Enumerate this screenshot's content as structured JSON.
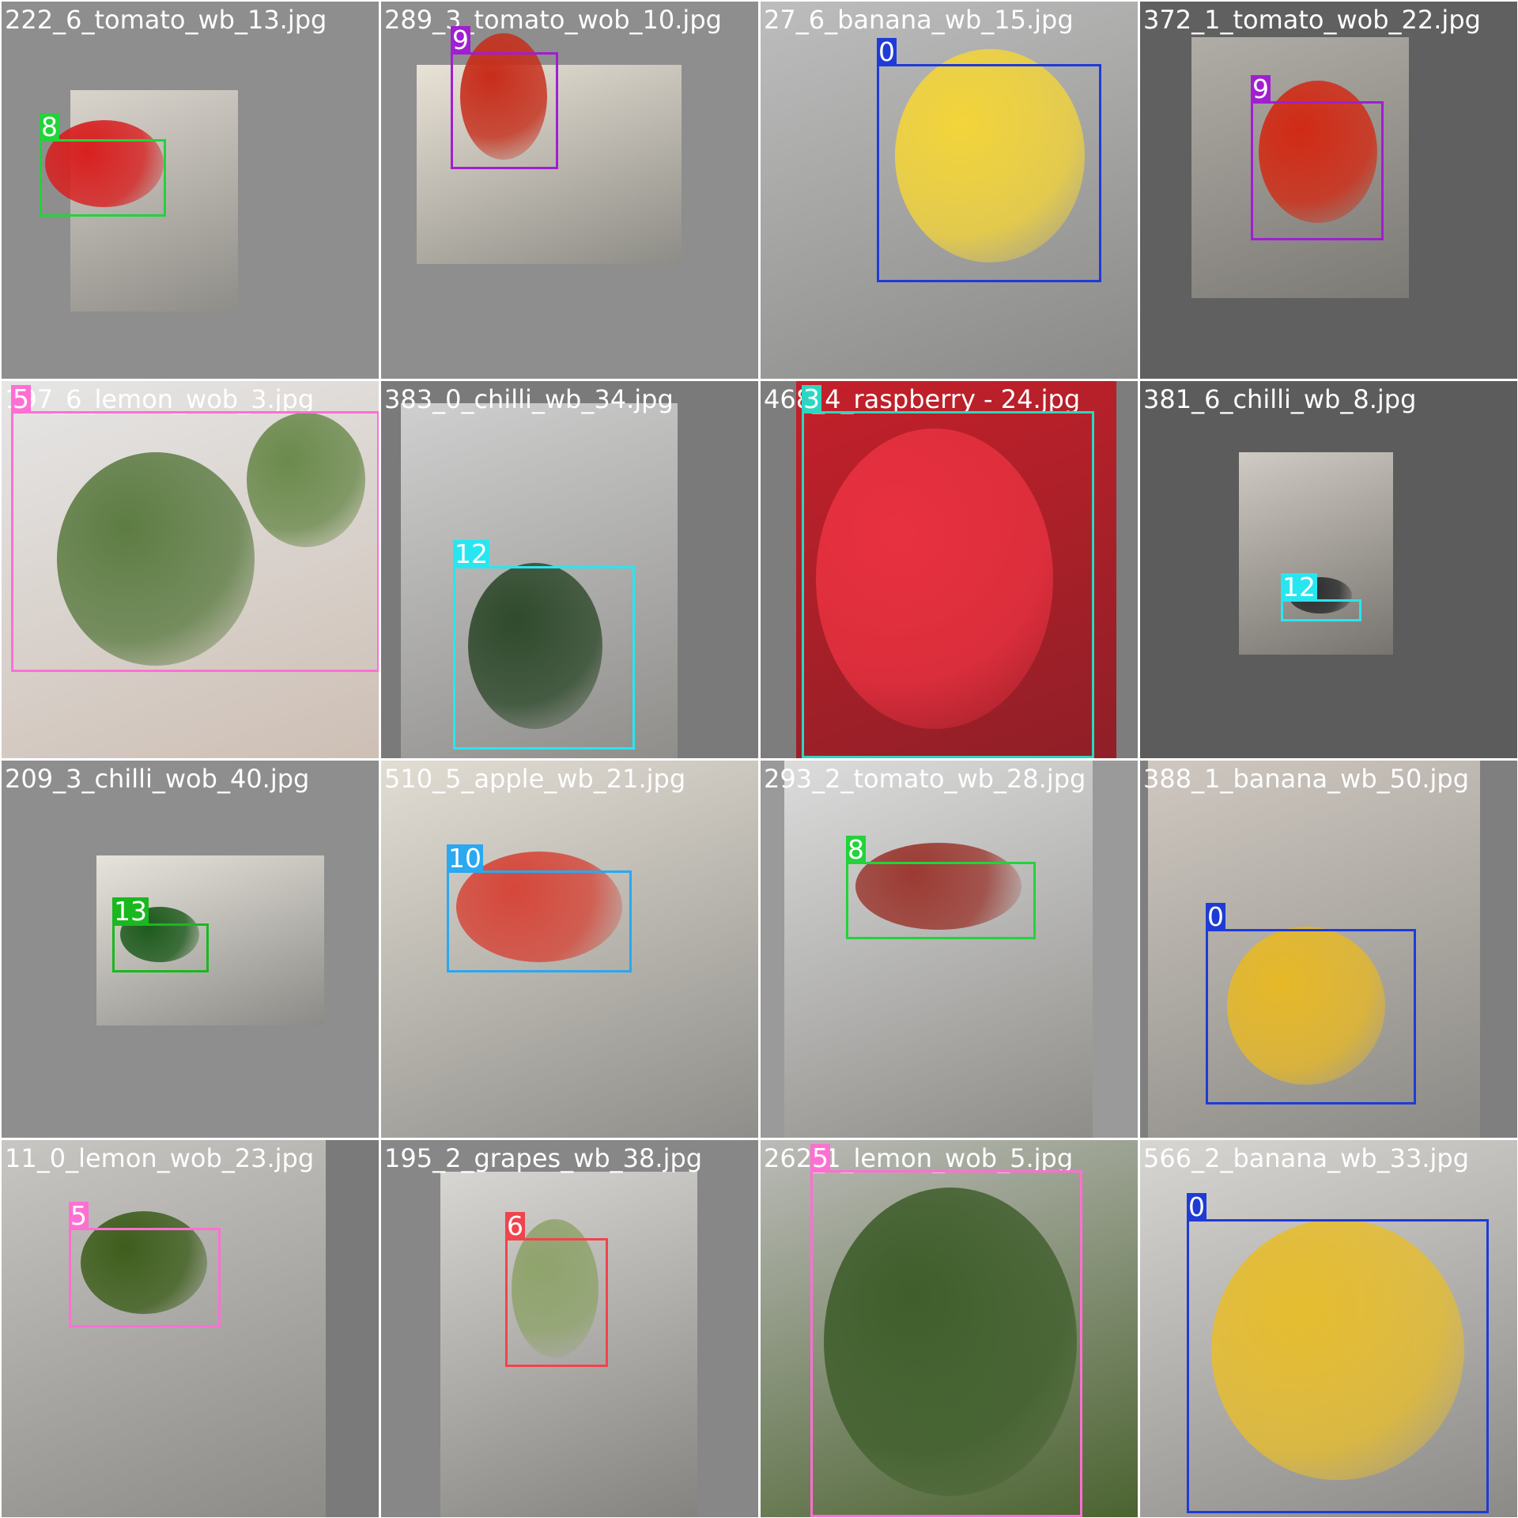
{
  "tiles": [
    {
      "filename": "222_6_tomato_wb_13.jpg",
      "boxes": [
        {
          "label": "8",
          "color": "#22d33a"
        }
      ]
    },
    {
      "filename": "289_3_tomato_wob_10.jpg",
      "boxes": [
        {
          "label": "9",
          "color": "#a01fd0"
        }
      ]
    },
    {
      "filename": "27_6_banana_wb_15.jpg",
      "boxes": [
        {
          "label": "0",
          "color": "#1f3bd6"
        }
      ]
    },
    {
      "filename": "372_1_tomato_wob_22.jpg",
      "boxes": [
        {
          "label": "9",
          "color": "#a01fd0"
        }
      ]
    },
    {
      "filename": "197_6_lemon_wob_3.jpg",
      "boxes": [
        {
          "label": "5",
          "color": "#ff6fd3"
        }
      ]
    },
    {
      "filename": "383_0_chilli_wb_34.jpg",
      "boxes": [
        {
          "label": "12",
          "color": "#28e6f0"
        }
      ]
    },
    {
      "filename": "468_4_raspberry - 24.jpg",
      "boxes": [
        {
          "label": "3",
          "color": "#2ed6c0"
        }
      ]
    },
    {
      "filename": "381_6_chilli_wb_8.jpg",
      "boxes": [
        {
          "label": "12",
          "color": "#28e6f0"
        }
      ]
    },
    {
      "filename": "209_3_chilli_wob_40.jpg",
      "boxes": [
        {
          "label": "13",
          "color": "#1ab81f"
        }
      ]
    },
    {
      "filename": "510_5_apple_wb_21.jpg",
      "boxes": [
        {
          "label": "10",
          "color": "#2aa8f0"
        }
      ]
    },
    {
      "filename": "293_2_tomato_wb_28.jpg",
      "boxes": [
        {
          "label": "8",
          "color": "#22d33a"
        }
      ]
    },
    {
      "filename": "388_1_banana_wb_50.jpg",
      "boxes": [
        {
          "label": "0",
          "color": "#1f3bd6"
        }
      ]
    },
    {
      "filename": "11_0_lemon_wob_23.jpg",
      "boxes": [
        {
          "label": "5",
          "color": "#ff6fd3"
        }
      ]
    },
    {
      "filename": "195_2_grapes_wb_38.jpg",
      "boxes": [
        {
          "label": "6",
          "color": "#f0444c"
        }
      ]
    },
    {
      "filename": "262_1_lemon_wob_5.jpg",
      "boxes": [
        {
          "label": "5",
          "color": "#ff6fd3"
        }
      ]
    },
    {
      "filename": "566_2_banana_wb_33.jpg",
      "boxes": [
        {
          "label": "0",
          "color": "#1f3bd6"
        }
      ]
    }
  ]
}
